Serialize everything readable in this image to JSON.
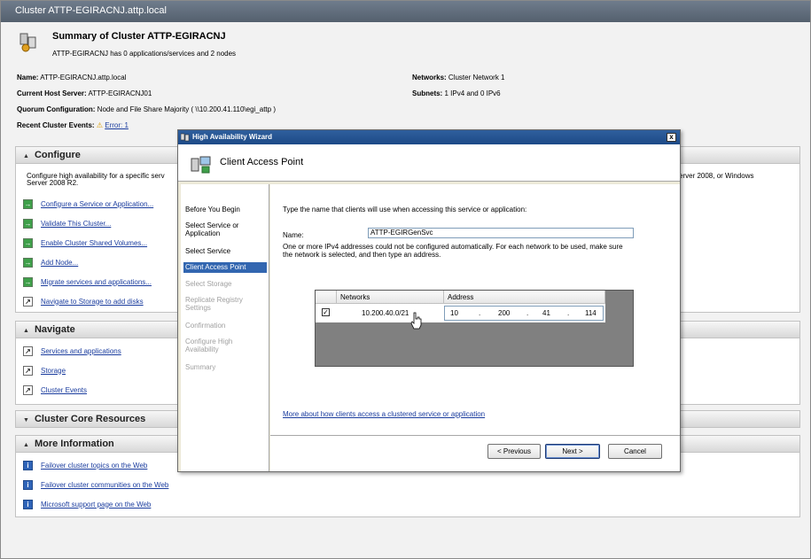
{
  "window": {
    "title": "Cluster ATTP-EGIRACNJ.attp.local"
  },
  "summary": {
    "title": "Summary of Cluster ATTP-EGIRACNJ",
    "subtitle": "ATTP-EGIRACNJ has 0 applications/services and 2 nodes",
    "name_label": "Name:",
    "name_value": "ATTP-EGIRACNJ.attp.local",
    "host_label": "Current Host Server:",
    "host_value": "ATTP-EGIRACNJ01",
    "quorum_label": "Quorum Configuration:",
    "quorum_value": "Node and File Share Majority ( \\\\10.200.41.110\\egi_attp )",
    "events_label": "Recent Cluster Events:",
    "events_value": "Error: 1",
    "networks_label": "Networks:",
    "networks_value": "Cluster Network 1",
    "subnets_label": "Subnets:",
    "subnets_value": "1 IPv4 and 0 IPv6"
  },
  "configure": {
    "title": "Configure",
    "desc_left": "Configure high availability for a specific serv",
    "desc_left2": "Server 2008 R2.",
    "desc_right": "erver 2008, or Windows",
    "items": [
      "Configure a Service or Application...",
      "Validate This Cluster...",
      "Enable Cluster Shared Volumes...",
      "Add Node...",
      "Migrate services and applications...",
      "Navigate to Storage to add disks"
    ]
  },
  "navigate": {
    "title": "Navigate",
    "items": [
      "Services and applications",
      "Storage",
      "Cluster Events"
    ]
  },
  "core": {
    "title": "Cluster Core Resources"
  },
  "more_info": {
    "title": "More Information",
    "items": [
      "Failover cluster topics on the Web",
      "Failover cluster communities on the Web",
      "Microsoft support page on the Web"
    ]
  },
  "wizard": {
    "title": "High Availability Wizard",
    "close": "x",
    "heading": "Client Access Point",
    "nav": [
      {
        "label": "Before You Begin",
        "state": "normal"
      },
      {
        "label": "Select Service or Application",
        "state": "normal"
      },
      {
        "label": "Select Service",
        "state": "normal"
      },
      {
        "label": "Client Access Point",
        "state": "active"
      },
      {
        "label": "Select Storage",
        "state": "disabled"
      },
      {
        "label": "Replicate Registry Settings",
        "state": "disabled"
      },
      {
        "label": "Confirmation",
        "state": "disabled"
      },
      {
        "label": "Configure High Availability",
        "state": "disabled"
      },
      {
        "label": "Summary",
        "state": "disabled"
      }
    ],
    "instruction": "Type the name that clients will use when accessing this service or application:",
    "name_label": "Name:",
    "name_value": "ATTP-EGIRGenSvc",
    "ipv4_msg1": "One or more IPv4 addresses could not be configured automatically.  For each network to be used, make sure",
    "ipv4_msg2": "the network is selected, and then type an address.",
    "grid": {
      "col_networks": "Networks",
      "col_address": "Address",
      "row_checked": "✓",
      "row_network": "10.200.40.0/21",
      "octets": [
        "10",
        ".",
        "200",
        ".",
        "41",
        ".",
        "114"
      ]
    },
    "more_link": "More about how clients access a clustered service or application",
    "btn_previous": "< Previous",
    "btn_next": "Next >",
    "btn_cancel": "Cancel"
  }
}
